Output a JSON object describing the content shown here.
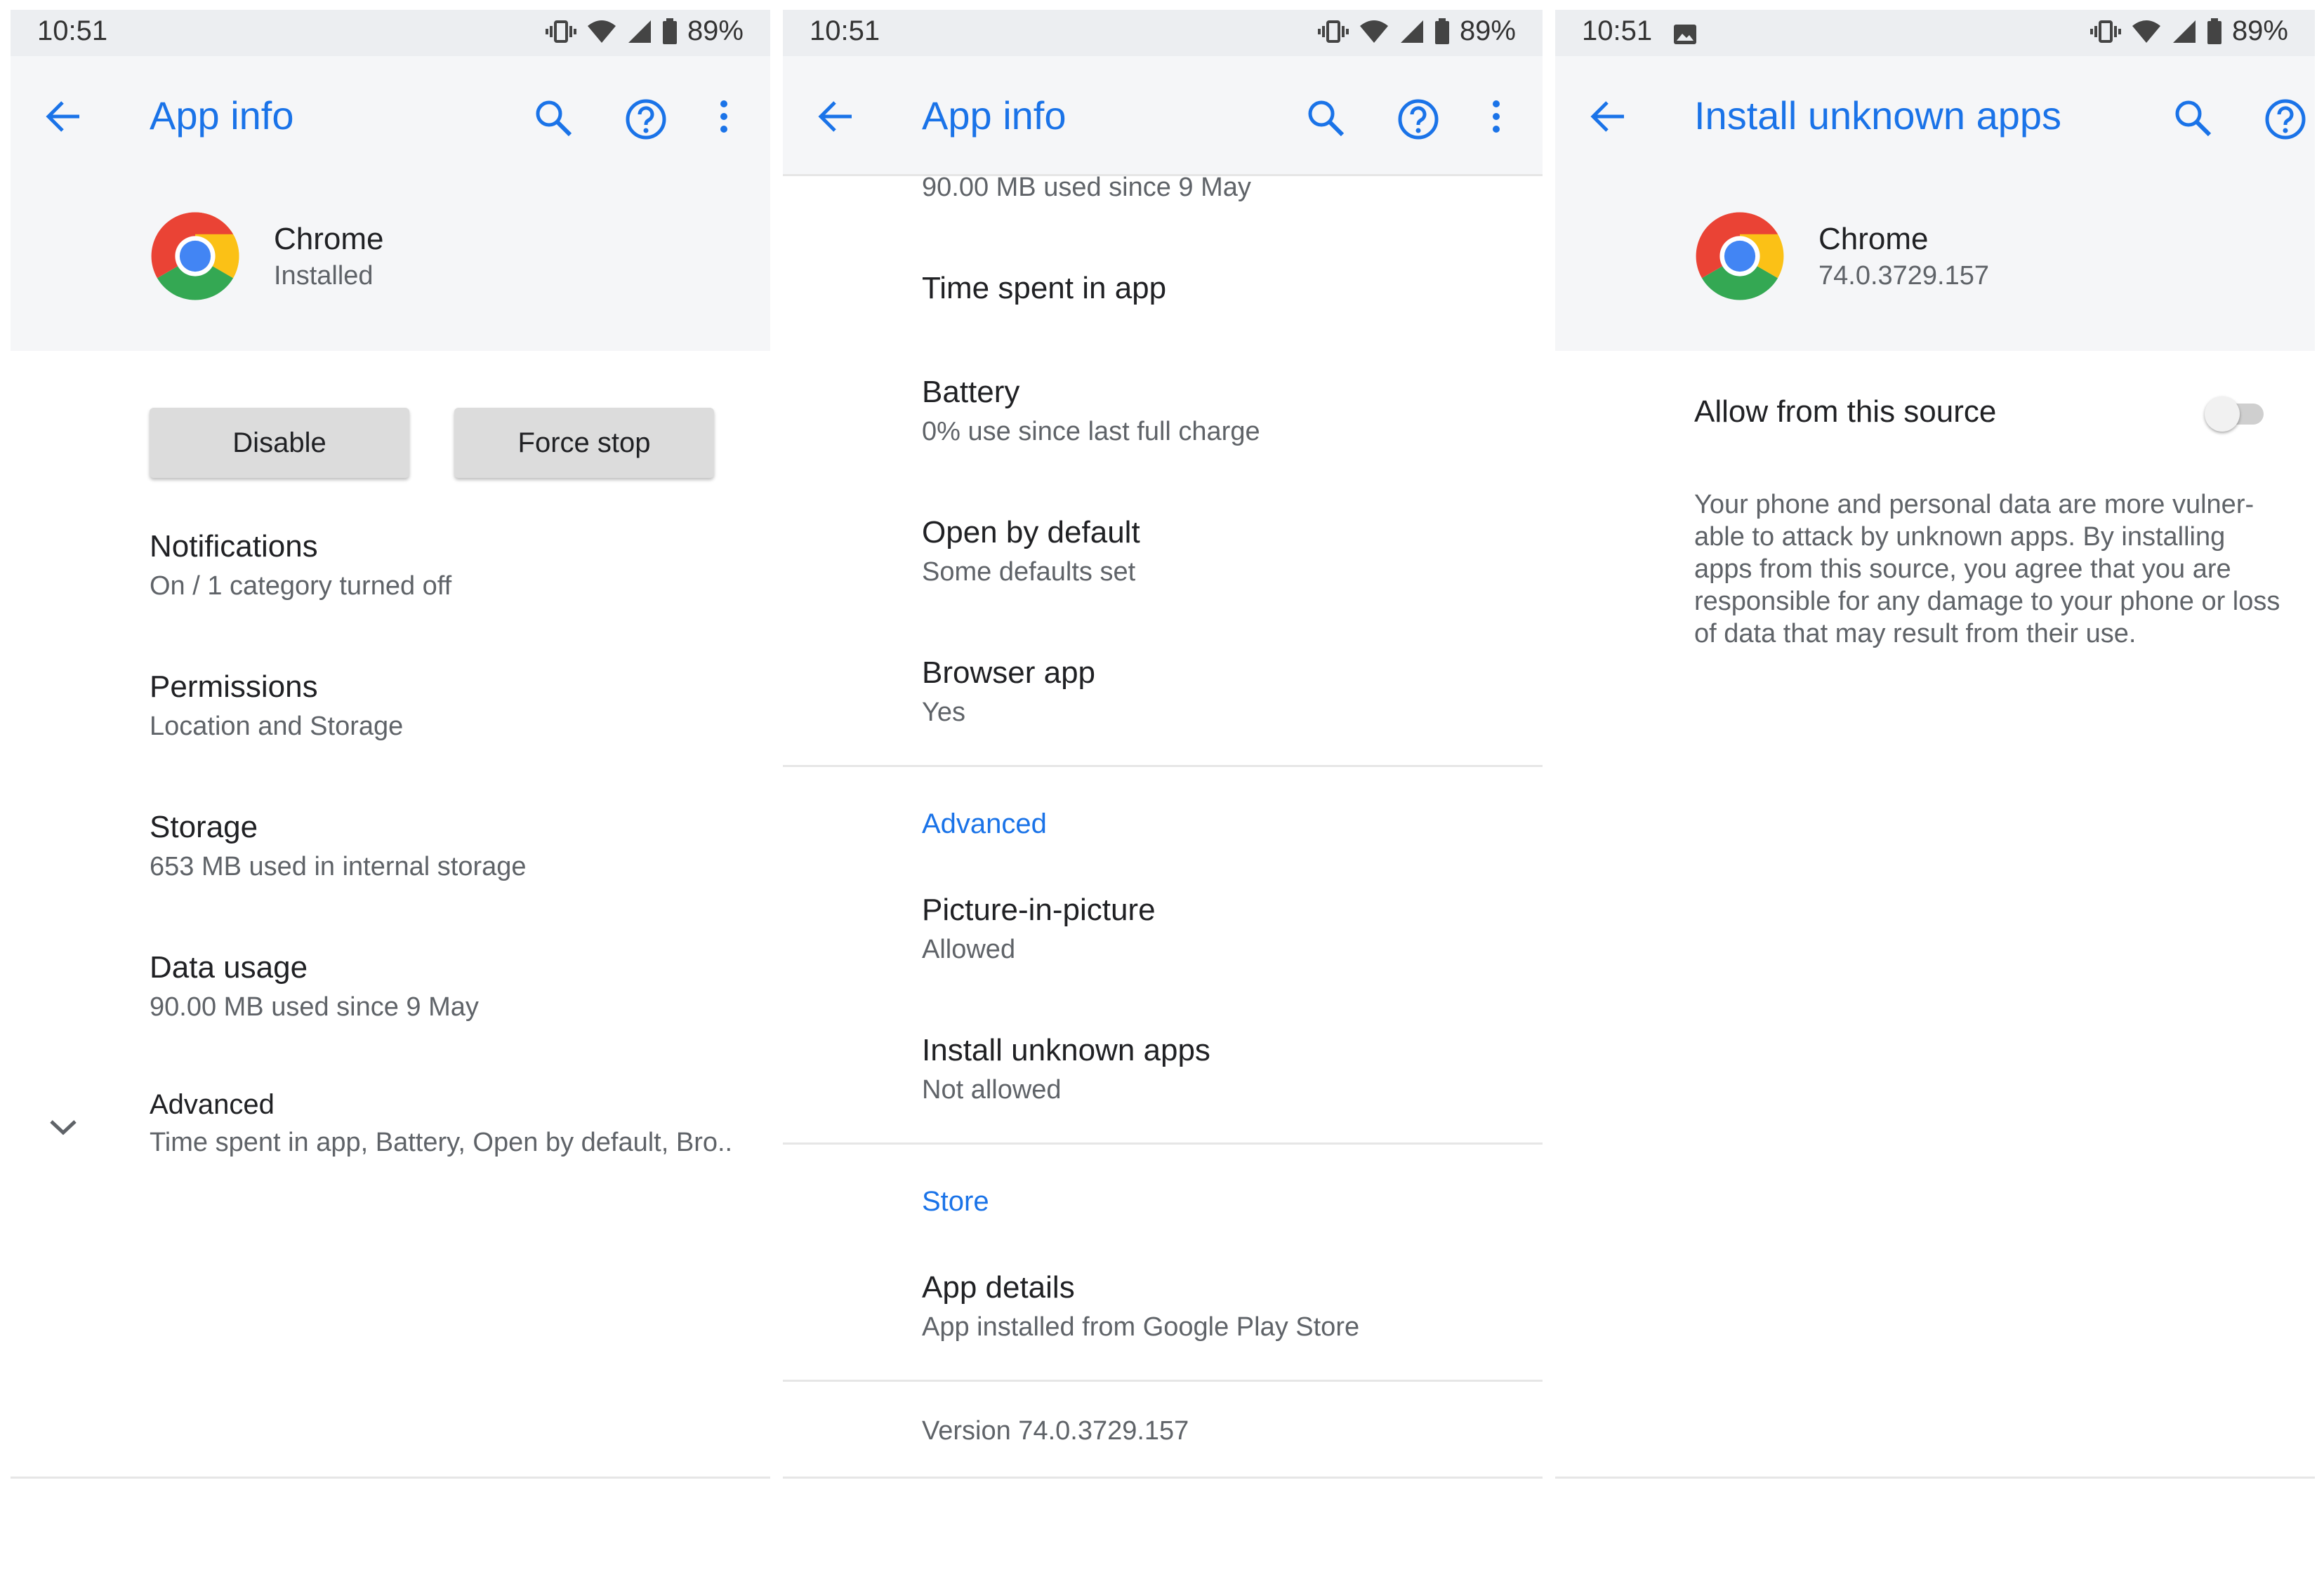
{
  "status_bar": {
    "time": "10:51",
    "battery": "89%"
  },
  "colors": {
    "accent": "#1a73e8",
    "status_bg": "#eceef1",
    "header_bg": "#f5f6f8"
  },
  "screen1": {
    "title": "App info",
    "app": {
      "name": "Chrome",
      "status": "Installed"
    },
    "buttons": {
      "disable": "Disable",
      "force_stop": "Force stop"
    },
    "items": [
      {
        "title": "Notifications",
        "subtitle": "On / 1 category turned off"
      },
      {
        "title": "Permissions",
        "subtitle": "Location and Storage"
      },
      {
        "title": "Storage",
        "subtitle": "653 MB used in internal storage"
      },
      {
        "title": "Data usage",
        "subtitle": "90.00 MB used since 9 May"
      }
    ],
    "advanced": {
      "title": "Advanced",
      "subtitle": "Time spent in app, Battery, Open by default, Bro.."
    }
  },
  "screen2": {
    "title": "App info",
    "partial_item_subtitle": "90.00 MB used since 9 May",
    "items": [
      {
        "title": "Time spent in app",
        "subtitle": ""
      },
      {
        "title": "Battery",
        "subtitle": "0% use since last full charge"
      },
      {
        "title": "Open by default",
        "subtitle": "Some defaults set"
      },
      {
        "title": "Browser app",
        "subtitle": "Yes"
      }
    ],
    "section_advanced": "Advanced",
    "advanced_items": [
      {
        "title": "Picture-in-picture",
        "subtitle": "Allowed"
      },
      {
        "title": "Install unknown apps",
        "subtitle": "Not allowed"
      }
    ],
    "section_store": "Store",
    "store_items": [
      {
        "title": "App details",
        "subtitle": "App installed from Google Play Store"
      }
    ],
    "version": "Version 74.0.3729.157"
  },
  "screen3": {
    "title": "Install unknown apps",
    "app": {
      "name": "Chrome",
      "version": "74.0.3729.157"
    },
    "toggle_label": "Allow from this source",
    "toggle_on": false,
    "description": "Your phone and personal data are more vulner-able to attack by unknown apps. By installing apps from this source, you agree that you are responsible for any damage to your phone or loss of data that may result from their use."
  },
  "icons": [
    "vibrate-icon",
    "wifi-icon",
    "signal-icon",
    "battery-icon",
    "image-icon",
    "back-arrow-icon",
    "search-icon",
    "help-icon",
    "more-vert-icon",
    "chrome-logo-icon",
    "chevron-down-icon",
    "nav-back-icon",
    "nav-home-pill"
  ]
}
